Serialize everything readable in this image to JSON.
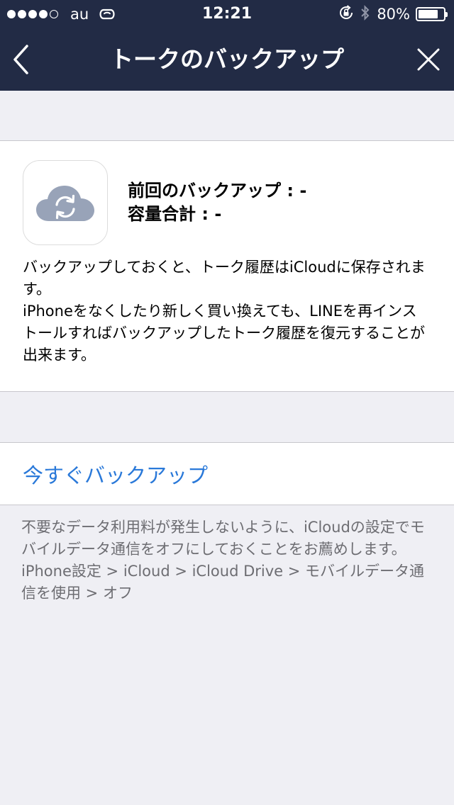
{
  "status_bar": {
    "carrier": "au",
    "time": "12:21",
    "battery_percent": "80%",
    "battery_level": 0.8,
    "signal_dots_filled": 4,
    "signal_dots_total": 5,
    "icons": [
      "wifi-calling-icon",
      "orientation-lock-icon",
      "bluetooth-icon",
      "battery-icon"
    ]
  },
  "nav": {
    "title": "トークのバックアップ",
    "back_icon": "chevron-left-icon",
    "close_icon": "close-icon"
  },
  "backup": {
    "icon": "icloud-sync-icon",
    "last_backup_label": "前回のバックアップ",
    "last_backup_value": "-",
    "total_size_label": "容量合計",
    "total_size_value": "-",
    "description": [
      "バックアップしておくと、トーク履歴はiCloudに保存されます。",
      "iPhoneをなくしたり新しく買い換えても、LINEを再インストールすればバックアップしたトーク履歴を復元することが出来ます。"
    ]
  },
  "action": {
    "backup_now_label": "今すぐバックアップ"
  },
  "note": {
    "text": "不要なデータ利用料が発生しないように、iCloudの設定でモバイルデータ通信をオフにしておくことをお薦めします。",
    "path": "iPhone設定 > iCloud > iCloud Drive > モバイルデータ通信を使用 > オフ"
  },
  "colors": {
    "nav_background": "#222b45",
    "page_background": "#efeff4",
    "link_blue": "#2a79d9",
    "cloud_gray": "#98a3b8",
    "note_gray": "#6d6d72"
  }
}
